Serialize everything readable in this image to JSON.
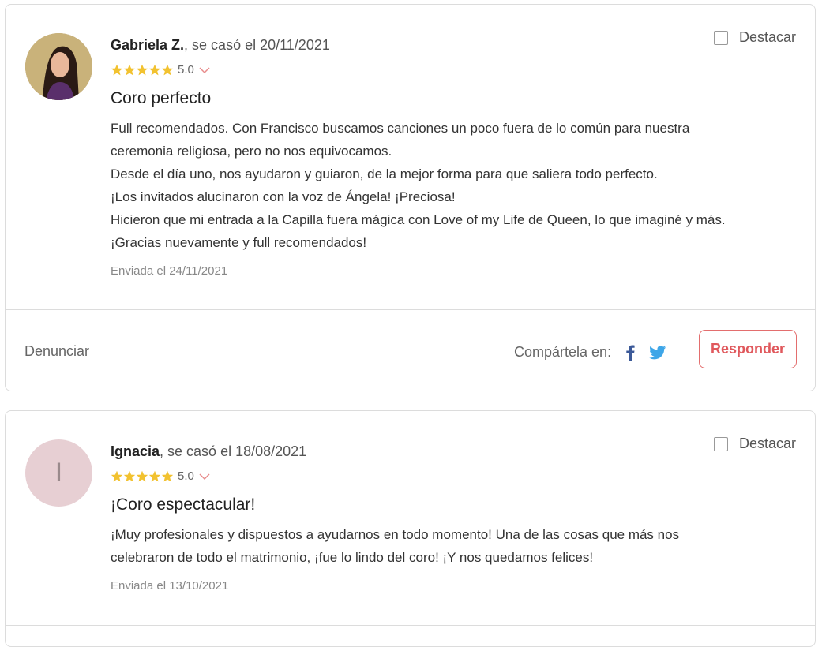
{
  "reviews": [
    {
      "name": "Gabriela Z.",
      "married_text": ", se casó el 20/11/2021",
      "rating": "5.0",
      "title": "Coro perfecto",
      "body_lines": [
        "Full recomendados. Con Francisco buscamos canciones un poco fuera de lo común para nuestra",
        "ceremonia religiosa, pero no nos equivocamos.",
        "Desde el día uno, nos ayudaron y guiaron, de la mejor forma para que saliera todo perfecto.",
        "¡Los invitados alucinaron con la voz de Ángela! ¡Preciosa!",
        "Hicieron que mi entrada a la Capilla fuera mágica con Love of my Life de Queen, lo que imaginé y más.",
        "¡Gracias nuevamente y full recomendados!"
      ],
      "sent": "Enviada el 24/11/2021",
      "feature_label": "Destacar"
    },
    {
      "name": "Ignacia",
      "married_text": ", se casó el 18/08/2021",
      "avatar_initial": "I",
      "rating": "5.0",
      "title": "¡Coro espectacular!",
      "body_lines": [
        "¡Muy profesionales y dispuestos a ayudarnos en todo momento! Una de las cosas que más nos",
        "celebraron de todo el matrimonio, ¡fue lo lindo del coro! ¡Y nos quedamos felices!"
      ],
      "sent": "Enviada el 13/10/2021",
      "feature_label": "Destacar"
    }
  ],
  "actions": {
    "report_label": "Denunciar",
    "share_label": "Compártela en:",
    "reply_label": "Responder"
  },
  "colors": {
    "star": "#f2c230",
    "accent": "#e0595d",
    "facebook": "#3b5998",
    "twitter": "#1da1f2"
  },
  "icons": [
    "star-icon",
    "chevron-down-icon",
    "facebook-icon",
    "twitter-icon",
    "checkbox-icon"
  ]
}
